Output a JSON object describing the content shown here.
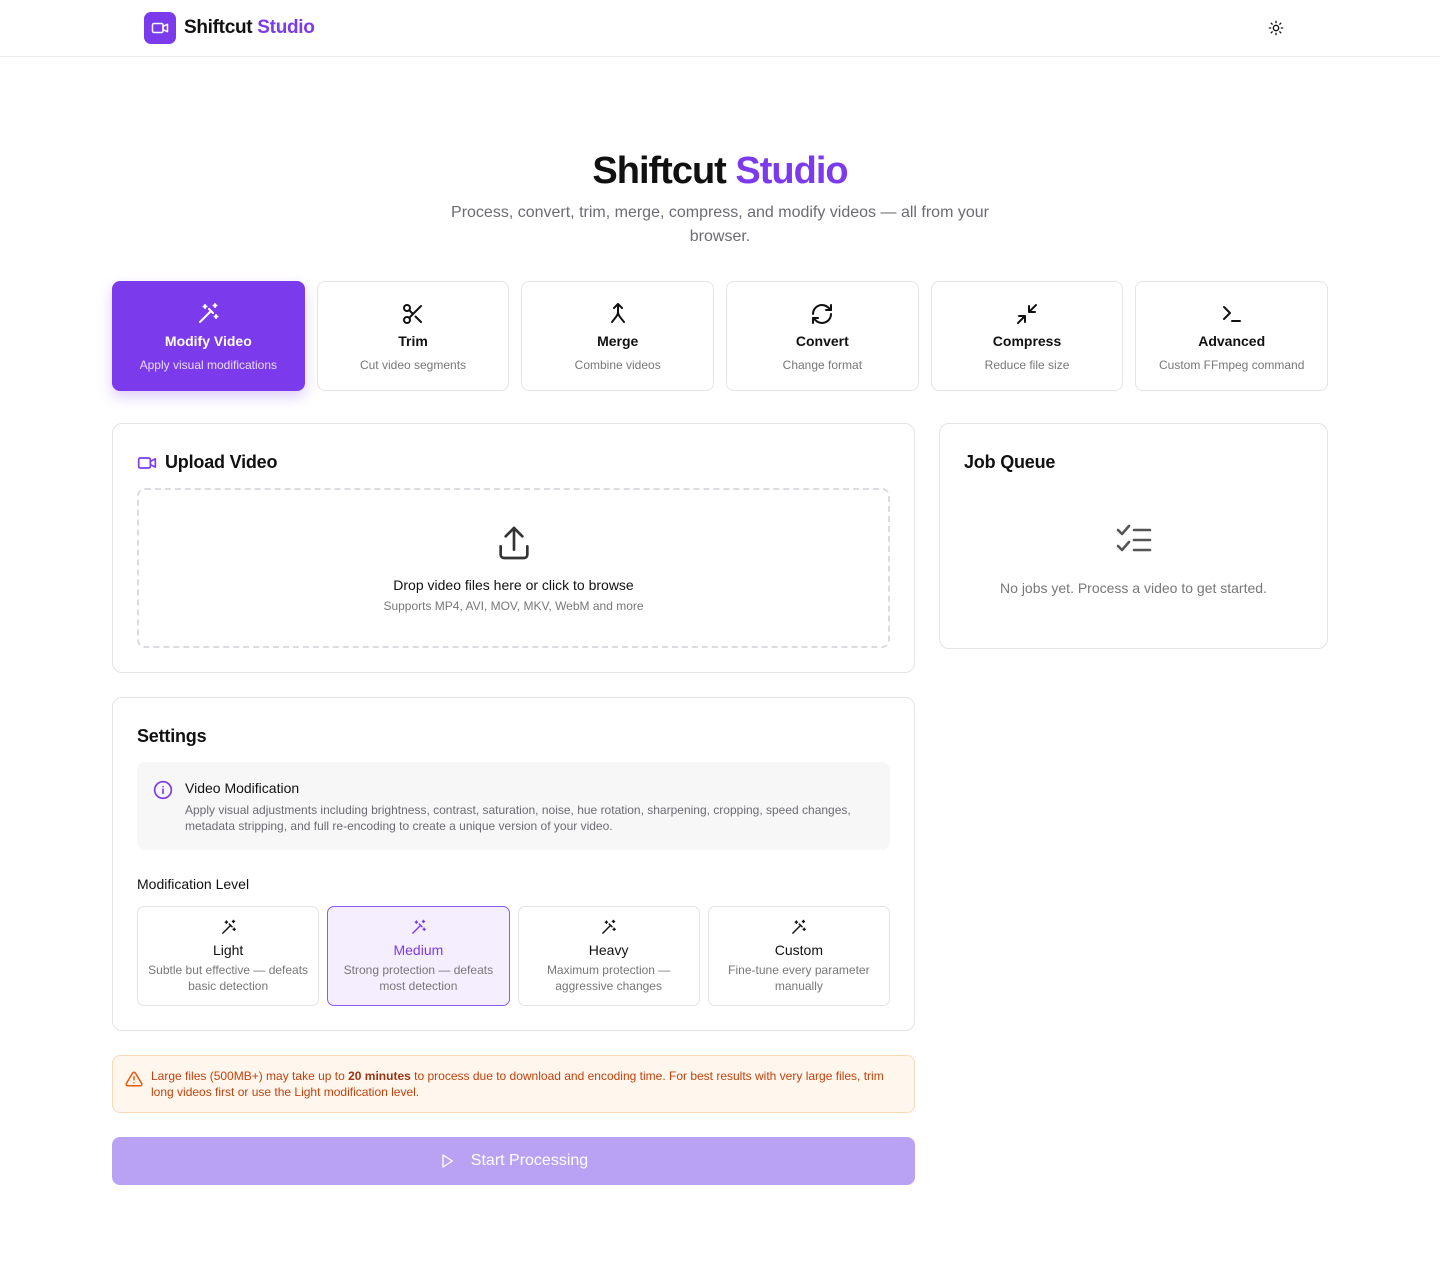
{
  "brand": {
    "name": "Shiftcut",
    "accent_word": "Studio",
    "accent_color": "#7c3aed"
  },
  "header": {
    "logo_icon": "video-camera-icon",
    "theme_toggle_icon": "sun-icon"
  },
  "hero": {
    "title": "Shiftcut",
    "title_accent": "Studio",
    "subtitle": "Process, convert, trim, merge, compress, and modify videos — all from your browser."
  },
  "tools": [
    {
      "title": "Modify Video",
      "desc": "Apply visual modifications",
      "icon": "magic-wand-icon",
      "active": true
    },
    {
      "title": "Trim",
      "desc": "Cut video segments",
      "icon": "scissors-icon",
      "active": false
    },
    {
      "title": "Merge",
      "desc": "Combine videos",
      "icon": "merge-icon",
      "active": false
    },
    {
      "title": "Convert",
      "desc": "Change format",
      "icon": "refresh-icon",
      "active": false
    },
    {
      "title": "Compress",
      "desc": "Reduce file size",
      "icon": "minimize-icon",
      "active": false
    },
    {
      "title": "Advanced",
      "desc": "Custom FFmpeg command",
      "icon": "terminal-icon",
      "active": false
    }
  ],
  "upload": {
    "heading": "Upload Video",
    "drop_title": "Drop video files here or click to browse",
    "drop_sub": "Supports MP4, AVI, MOV, MKV, WebM and more"
  },
  "queue": {
    "heading": "Job Queue",
    "empty_text": "No jobs yet. Process a video to get started."
  },
  "settings": {
    "heading": "Settings",
    "info_title": "Video Modification",
    "info_desc": "Apply visual adjustments including brightness, contrast, saturation, noise, hue rotation, sharpening, cropping, speed changes, metadata stripping, and full re-encoding to create a unique version of your video.",
    "level_label": "Modification Level",
    "levels": [
      {
        "title": "Light",
        "desc": "Subtle but effective — defeats basic detection",
        "selected": false
      },
      {
        "title": "Medium",
        "desc": "Strong protection — defeats most detection",
        "selected": true
      },
      {
        "title": "Heavy",
        "desc": "Maximum protection — aggressive changes",
        "selected": false
      },
      {
        "title": "Custom",
        "desc": "Fine-tune every parameter manually",
        "selected": false
      }
    ]
  },
  "warning": {
    "before": "Large files (500MB+) may take up to ",
    "bold": "20 minutes",
    "after": " to process due to download and encoding time. For best results with very large files, trim long videos first or use the Light modification level."
  },
  "start_button": {
    "label": "Start Processing",
    "icon": "play-icon",
    "disabled": true
  }
}
